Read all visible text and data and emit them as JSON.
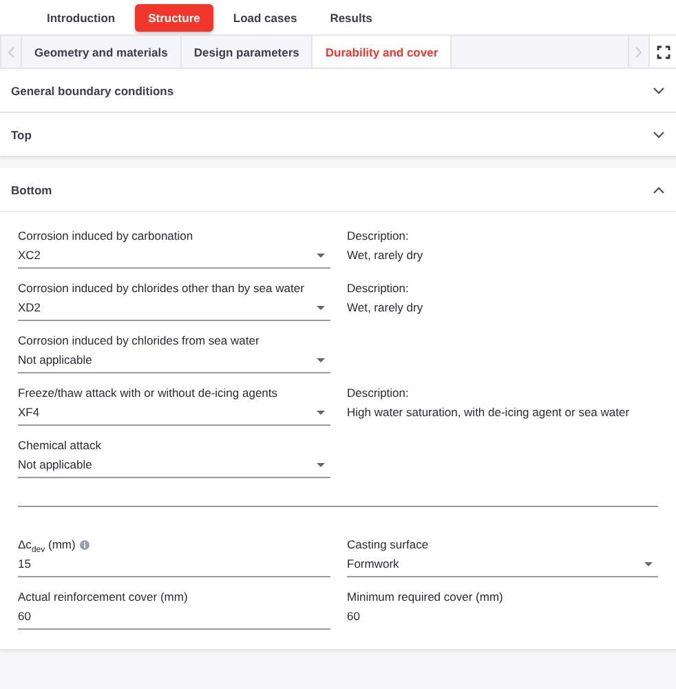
{
  "main_tabs": [
    {
      "label": "Introduction",
      "selected": false
    },
    {
      "label": "Structure",
      "selected": true
    },
    {
      "label": "Load cases",
      "selected": false
    },
    {
      "label": "Results",
      "selected": false
    }
  ],
  "sub_tabs": [
    {
      "label": "Geometry and materials",
      "selected": false
    },
    {
      "label": "Design parameters",
      "selected": false
    },
    {
      "label": "Durability and cover",
      "selected": true
    }
  ],
  "sections": [
    {
      "title": "General boundary conditions",
      "expanded": false
    },
    {
      "title": "Top",
      "expanded": false
    },
    {
      "title": "Bottom",
      "expanded": true
    }
  ],
  "exposure_rows": [
    {
      "label": "Corrosion induced by carbonation",
      "value": "XC2",
      "description_label": "Description:",
      "description": "Wet, rarely dry"
    },
    {
      "label": "Corrosion induced by chlorides other than by sea water",
      "value": "XD2",
      "description_label": "Description:",
      "description": "Wet, rarely dry"
    },
    {
      "label": "Corrosion induced by chlorides from sea water",
      "value": "Not applicable"
    },
    {
      "label": "Freeze/thaw attack with or without de-icing agents",
      "value": "XF4",
      "description_label": "Description:",
      "description": "High water saturation, with de-icing agent or sea water"
    },
    {
      "label": "Chemical attack",
      "value": "Not applicable"
    }
  ],
  "cover_fields": [
    {
      "kind": "input",
      "label": "Δc$_{dev}$ (mm)",
      "value": "15",
      "info": true
    },
    {
      "kind": "select",
      "label": "Casting surface",
      "value": "Formwork"
    },
    {
      "kind": "input",
      "label": "Actual reinforcement cover (mm)",
      "value": "60"
    },
    {
      "kind": "readonly",
      "label": "Minimum required cover (mm)",
      "value": "60"
    }
  ]
}
